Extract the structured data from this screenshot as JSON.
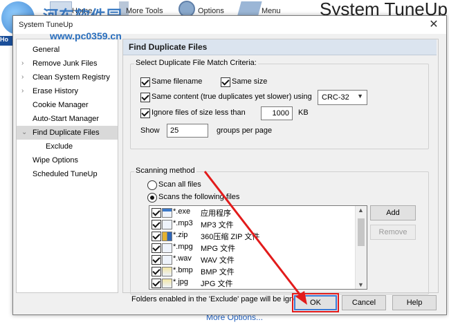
{
  "background": {
    "toolbar": [
      {
        "label": "Home",
        "icon": "home-icon"
      },
      {
        "label": "More Tools",
        "icon": "tools-icon"
      },
      {
        "label": "Options",
        "icon": "gear-icon"
      },
      {
        "label": "Menu",
        "icon": "menu-icon"
      }
    ],
    "app_title": "System TuneUp",
    "left_stub": "Ho",
    "more_options": "More Options...",
    "watermark": {
      "line1": "河东软件园",
      "line2": "www.pc0359.cn"
    }
  },
  "dialog": {
    "title": "System TuneUp",
    "close_label": "✕"
  },
  "tree": {
    "items": [
      {
        "label": "General",
        "chevron": false,
        "indent": 0,
        "selected": false
      },
      {
        "label": "Remove Junk Files",
        "chevron": true,
        "indent": 0,
        "selected": false
      },
      {
        "label": "Clean System Registry",
        "chevron": true,
        "indent": 0,
        "selected": false
      },
      {
        "label": "Erase History",
        "chevron": true,
        "indent": 0,
        "selected": false
      },
      {
        "label": "Cookie Manager",
        "chevron": false,
        "indent": 0,
        "selected": false
      },
      {
        "label": "Auto-Start Manager",
        "chevron": false,
        "indent": 0,
        "selected": false
      },
      {
        "label": "Find Duplicate Files",
        "chevron": "expanded",
        "indent": 0,
        "selected": true
      },
      {
        "label": "Exclude",
        "chevron": false,
        "indent": 1,
        "selected": false
      },
      {
        "label": "Wipe Options",
        "chevron": false,
        "indent": 0,
        "selected": false
      },
      {
        "label": "Scheduled TuneUp",
        "chevron": false,
        "indent": 0,
        "selected": false
      }
    ]
  },
  "panel": {
    "title": "Find Duplicate Files",
    "criteria": {
      "legend": "Select Duplicate File Match Criteria:",
      "same_filename": {
        "label": "Same filename",
        "checked": true
      },
      "same_size": {
        "label": "Same size",
        "checked": true
      },
      "same_content": {
        "label": "Same content (true duplicates yet slower) using",
        "checked": true
      },
      "algorithm": "CRC-32",
      "ignore_small": {
        "label": "Ignore files of size less than",
        "checked": true
      },
      "ignore_value": "1000",
      "ignore_unit": "KB",
      "show_label": "Show",
      "show_value": "25",
      "show_suffix": "groups per page"
    },
    "scanning": {
      "legend": "Scanning method",
      "scan_all": {
        "label": "Scan all files",
        "selected": false
      },
      "scan_following": {
        "label": "Scans the following files",
        "selected": true
      },
      "files": [
        {
          "ext": "*.exe",
          "desc": "应用程序",
          "icon": "exe",
          "checked": true
        },
        {
          "ext": "*.mp3",
          "desc": "MP3 文件",
          "icon": "doc",
          "checked": true
        },
        {
          "ext": "*.zip",
          "desc": "360压缩 ZIP 文件",
          "icon": "zip",
          "checked": true
        },
        {
          "ext": "*.mpg",
          "desc": "MPG 文件",
          "icon": "doc",
          "checked": true
        },
        {
          "ext": "*.wav",
          "desc": "WAV 文件",
          "icon": "doc",
          "checked": true
        },
        {
          "ext": "*.bmp",
          "desc": "BMP 文件",
          "icon": "img",
          "checked": true
        },
        {
          "ext": "*.jpg",
          "desc": "JPG 文件",
          "icon": "img",
          "checked": true
        }
      ],
      "add_label": "Add",
      "remove_label": "Remove"
    },
    "footnote": "Folders enabled in the 'Exclude' page will be ignored"
  },
  "buttons": {
    "ok": "OK",
    "cancel": "Cancel",
    "help": "Help"
  },
  "colors": {
    "accent": "#3a7bd5",
    "annotation": "#e21b1b",
    "header_bg": "#dbe4ef"
  }
}
